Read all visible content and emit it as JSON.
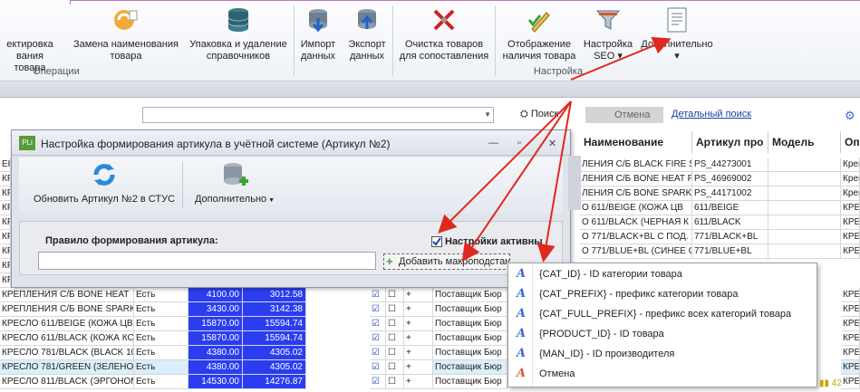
{
  "ribbon": {
    "buttons": [
      {
        "name": "edit-article-button",
        "lines": [
          "ектировка",
          "вания товара"
        ]
      },
      {
        "name": "rename-product-button",
        "lines": [
          "Замена наименования",
          "товара"
        ]
      },
      {
        "name": "pack-delete-dirs-button",
        "lines": [
          "Упаковка и удаление",
          "справочников"
        ]
      },
      {
        "name": "import-data-button",
        "lines": [
          "Импорт",
          "данных"
        ]
      },
      {
        "name": "export-data-button",
        "lines": [
          "Экспорт",
          "данных"
        ]
      },
      {
        "name": "clear-compare-button",
        "lines": [
          "Очистка товаров",
          "для сопоставления"
        ]
      },
      {
        "name": "show-availability-button",
        "lines": [
          "Отображение",
          "наличия товара"
        ]
      },
      {
        "name": "seo-settings-button",
        "lines": [
          "Настройка",
          "SEO ▾"
        ]
      },
      {
        "name": "additional-button",
        "lines": [
          "Дополнительно",
          "▾"
        ]
      }
    ],
    "groups": {
      "operations": "Операции",
      "settings": "Настройка"
    }
  },
  "search": {
    "search_label": "Поиск",
    "cancel_label": "Отмена",
    "advanced_label": "Детальный поиск"
  },
  "grid": {
    "headers": {
      "name": "Наименование",
      "article": "Артикул про",
      "model": "Модель",
      "opt": "Опи"
    },
    "right_rows": [
      {
        "name": "ЛЕНИЯ С/Б BLACK FIRE SP",
        "art": "PS_44273001",
        "opt": "Креп"
      },
      {
        "name": "ЛЕНИЯ С/Б BONE HEAT P.",
        "art": "PS_46969002",
        "opt": "Креп"
      },
      {
        "name": "ЛЕНИЯ С/Б BONE SPARK P",
        "art": "PS_44171002",
        "opt": "Креп"
      },
      {
        "name": "О 611/BEIGE (КОЖА ЦВ",
        "art": "611/BEIGE",
        "opt": "КРЕС"
      },
      {
        "name": "О 611/BLACK (ЧЕРНАЯ К",
        "art": "611/BLACK",
        "opt": "КРЕС"
      },
      {
        "name": "О 771/BLACK+BL С ПОД.",
        "art": "771/BLACK+BL",
        "opt": "КРЕС"
      },
      {
        "name": "О 771/BLUE+BL (СИНЕЕ С",
        "art": "771/BLUE+BL",
        "opt": "КРЕС"
      }
    ],
    "left_rows": [
      "ЕКТИРОВКА",
      "КРЕПЛЕНИЯ С/Б BLACK",
      "КРЕПЛЕНИЯ С/Б BONE",
      "КРЕПЛЕНИЯ С/Б BONE SPARK",
      "КРЕСЛО 611/BEIGE",
      "КРЕСЛО 611/BLACK",
      "КРЕСЛО 771/BLACK",
      "КРЕСЛО 771/BLUE",
      "КРЕПЛЕНИЯ С/Б BONE"
    ],
    "bottom_rows": [
      {
        "name": "КРЕПЛЕНИЯ С/Б BONE HEAT",
        "status": "Есть",
        "p1": "4100.00",
        "p2": "3012.58",
        "supplier": "Поставщик Бюр",
        "opt": "КРЕС"
      },
      {
        "name": "КРЕПЛЕНИЯ С/Б BONE SPARK",
        "status": "Есть",
        "p1": "3430.00",
        "p2": "3142.38",
        "supplier": "Поставщик Бюр",
        "opt": "КРЕС"
      },
      {
        "name": "КРЕСЛО 611/BEIGE (КОЖА ЦВ",
        "status": "Есть",
        "p1": "15870.00",
        "p2": "15594.74",
        "supplier": "Поставщик Бюр",
        "opt": "КРЕС"
      },
      {
        "name": "КРЕСЛО 611/BLACK (КОЖА КС",
        "status": "Есть",
        "p1": "15870.00",
        "p2": "15594.74",
        "supplier": "Поставщик Бюр",
        "opt": "КРЕС"
      },
      {
        "name": "КРЕСЛО 781/BLACK (BLACK 10",
        "status": "Есть",
        "p1": "4380.00",
        "p2": "4305.02",
        "supplier": "Поставщик Бюр",
        "opt": "КРЕС"
      },
      {
        "name": "КРЕСЛО 781/GREEN (ЗЕЛЕНОЕ",
        "status": "Есть",
        "p1": "4380.00",
        "p2": "4305.02",
        "supplier": "Поставщик Бюр",
        "opt": "КРЕС"
      },
      {
        "name": "КРЕСЛО 811/BLACK (ЭРГОНОМ",
        "status": "Есть",
        "p1": "14530.00",
        "p2": "14276.87",
        "supplier": "Поставщик Бюр",
        "opt": "КРЕС"
      }
    ]
  },
  "dialog": {
    "title": "Настройка формирования артикула в учётной системе (Артикул №2)",
    "logo": "PLi",
    "refresh_label": "Обновить Артикул №2 в СТУС",
    "more_label": "Дополнительно",
    "rule_label": "Правило формирования артикула:",
    "active_label": "Настройки активны",
    "macro_label": "Добавить макроподстановку"
  },
  "menu": {
    "items": [
      "{CAT_ID} - ID категории товара",
      "{CAT_PREFIX} - префикс категории товара",
      "{CAT_FULL_PREFIX} - префикс всех категорий товара",
      "{PRODUCT_ID} - ID товара",
      "{MAN_ID} - ID производителя",
      "Отмена"
    ]
  },
  "colors": {
    "selection": "#2a3ef0",
    "arrow": "#e0281e",
    "accent": "#3a6bd0"
  }
}
